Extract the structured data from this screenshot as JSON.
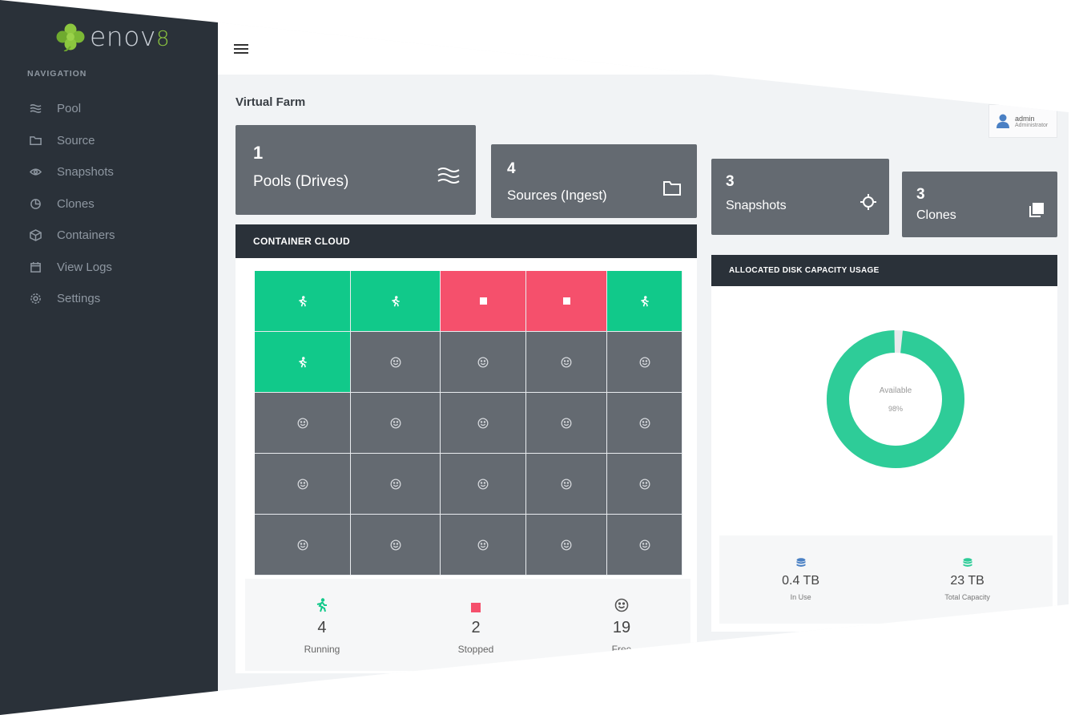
{
  "brand": {
    "name": "enov",
    "suffix": "8",
    "accent": "#8cc63f"
  },
  "nav": {
    "heading": "NAVIGATION",
    "items": [
      {
        "label": "Pool",
        "icon": "waves-icon"
      },
      {
        "label": "Source",
        "icon": "folder-icon"
      },
      {
        "label": "Snapshots",
        "icon": "eye-icon"
      },
      {
        "label": "Clones",
        "icon": "copy-icon"
      },
      {
        "label": "Containers",
        "icon": "box-icon"
      },
      {
        "label": "View Logs",
        "icon": "calendar-icon"
      },
      {
        "label": "Settings",
        "icon": "gear-icon"
      }
    ]
  },
  "page": {
    "title": "Virtual Farm"
  },
  "user": {
    "name": "admin",
    "role": "Administrator"
  },
  "cards": [
    {
      "value": "1",
      "label": "Pools (Drives)",
      "icon": "waves-icon"
    },
    {
      "value": "4",
      "label": "Sources (Ingest)",
      "icon": "folder-icon"
    },
    {
      "value": "3",
      "label": "Snapshots",
      "icon": "crosshair-icon"
    },
    {
      "value": "3",
      "label": "Clones",
      "icon": "copy-icon"
    }
  ],
  "container_cloud": {
    "title": "CONTAINER CLOUD",
    "cells": [
      "running",
      "running",
      "stopped",
      "stopped",
      "running",
      "running",
      "free",
      "free",
      "free",
      "free",
      "free",
      "free",
      "free",
      "free",
      "free",
      "free",
      "free",
      "free",
      "free",
      "free",
      "free",
      "free",
      "free",
      "free",
      "free"
    ],
    "summary": {
      "running": {
        "value": "4",
        "label": "Running"
      },
      "stopped": {
        "value": "2",
        "label": "Stopped"
      },
      "free": {
        "value": "19",
        "label": "Free"
      }
    },
    "colors": {
      "running": "#11c98a",
      "stopped": "#f5506c",
      "free": "#646a71"
    }
  },
  "disk": {
    "title": "ALLOCATED DISK CAPACITY USAGE",
    "center_label": "Available",
    "center_value": "98%",
    "available_pct": 98,
    "in_use": {
      "value": "0.4 TB",
      "label": "In Use"
    },
    "total": {
      "value": "23 TB",
      "label": "Total Capacity"
    },
    "colors": {
      "available": "#2ecc98",
      "used": "#e8eaec"
    }
  }
}
